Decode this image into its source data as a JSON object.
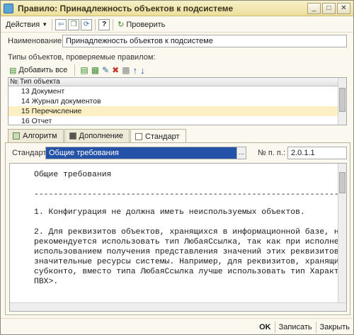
{
  "window": {
    "title": "Правило: Принадлежность  объектов к подсистеме"
  },
  "toolbar": {
    "actions_label": "Действия",
    "help_label": "?",
    "check_label": "Проверить"
  },
  "form": {
    "name_label": "Наименование:",
    "name_value": "Принадлежность  объектов к подсистеме",
    "types_label": "Типы объектов, проверяемые правилом:",
    "add_all_label": "Добавить все"
  },
  "grid": {
    "col_num": "№",
    "col_type": "Тип объекта",
    "rows": [
      {
        "text": "13 Документ",
        "selected": false
      },
      {
        "text": "14 Журнал документов",
        "selected": false
      },
      {
        "text": "15 Перечисление",
        "selected": true
      },
      {
        "text": "16 Отчет",
        "selected": false
      }
    ]
  },
  "tabs": [
    {
      "label": "Алгоритм"
    },
    {
      "label": "Дополнение"
    },
    {
      "label": "Стандарт"
    }
  ],
  "standard": {
    "label": "Стандарт:",
    "value": "Общие требования",
    "num_label": "№ п. п.:",
    "num_value": "2.0.1.1"
  },
  "text_lines": [
    "Общие требования",
    "------------------------------------------------------------------",
    "1. Конфигурация не должна иметь неиспользуемых объектов.",
    "2. Для реквизитов объектов, хранящихся в информационной базе, н",
    "рекомендуется использовать тип ЛюбаяСсылка, так как при исполне",
    "использованием получения представления значений этих реквизитов",
    "значительные ресурсы системы. Например, для реквизитов, хранящи",
    "субконто, вместо типа ЛюбаяСсылка лучше использовать тип Характ",
    "ПВХ>."
  ],
  "bottom": {
    "ok_label": "OK",
    "save_label": "Записать",
    "close_label": "Закрыть"
  }
}
